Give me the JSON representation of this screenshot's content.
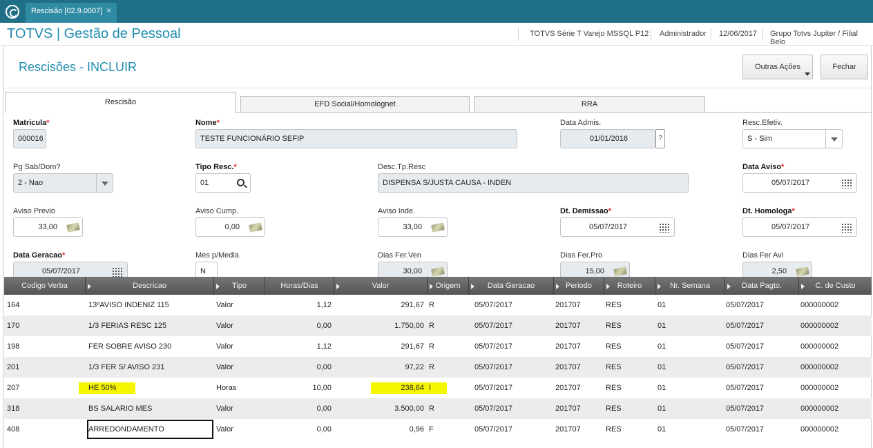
{
  "window": {
    "tab_title": "Rescisão [02.9.0007]",
    "close_glyph": "×"
  },
  "header": {
    "brand": "TOTVS | Gestão de Pessoal",
    "environment": "TOTVS Série T Varejo MSSQL P12",
    "user": "Administrador",
    "date": "12/06/2017",
    "company": "Grupo Totvs Jupiter / Filial Belo"
  },
  "page": {
    "title": "Rescisões - INCLUIR",
    "more_actions": "Outras Ações",
    "close": "Fechar"
  },
  "tabs": [
    "Rescisão",
    "EFD Social/Homolognet",
    "RRA"
  ],
  "form": {
    "matricula": {
      "label": "Matricula",
      "value": "000016",
      "required": "*"
    },
    "nome": {
      "label": "Nome",
      "value": "TESTE FUNCIONÁRIO SEFIP",
      "required": "*"
    },
    "data_admis": {
      "label": "Data Admis.",
      "value": "01/01/2016",
      "help": "?"
    },
    "resc_efetiv": {
      "label": "Resc.Efetiv.",
      "value": "S - Sim"
    },
    "pg_sab_dom": {
      "label": "Pg Sab/Dom?",
      "value": "2 - Nao"
    },
    "tipo_resc": {
      "label": "Tipo Resc.",
      "value": "01",
      "required": "*"
    },
    "desc_tp_resc": {
      "label": "Desc.Tp.Resc",
      "value": "DISPENSA S/JUSTA CAUSA - INDEN"
    },
    "data_aviso": {
      "label": "Data Aviso",
      "value": "05/07/2017",
      "required": "*"
    },
    "aviso_previo": {
      "label": "Aviso Previo",
      "value": "33,00"
    },
    "aviso_cump": {
      "label": "Aviso Cump.",
      "value": "0,00"
    },
    "aviso_inde": {
      "label": "Aviso Inde.",
      "value": "33,00"
    },
    "dt_demissao": {
      "label": "Dt. Demissao",
      "value": "05/07/2017",
      "required": "*"
    },
    "dt_homologa": {
      "label": "Dt. Homologa",
      "value": "05/07/2017",
      "required": "*"
    },
    "data_geracao": {
      "label": "Data Geracao",
      "value": "05/07/2017",
      "required": "*"
    },
    "mes_p_media": {
      "label": "Mes p/Media",
      "value": "N"
    },
    "dias_fer_ven": {
      "label": "Dias Fer.Ven",
      "value": "30,00"
    },
    "dias_fer_pro": {
      "label": "Dias Fer.Pro",
      "value": "15,00"
    },
    "dias_fer_avi": {
      "label": "Dias Fer Avi",
      "value": "2,50"
    }
  },
  "grid": {
    "columns": [
      "Codigo Verba",
      "Descricao",
      "Tipo",
      "Horas/Dias",
      "Valor",
      "Origem",
      "Data Geracao",
      "Periodo",
      "Roteiro",
      "Nr. Semana",
      "Data Pagto.",
      "C. de Custo"
    ],
    "rows": [
      [
        "164",
        "13ºAVISO INDENIZ 115",
        "Valor",
        "1,12",
        "291,67",
        "R",
        "05/07/2017",
        "201707",
        "RES",
        "01",
        "05/07/2017",
        "000000002"
      ],
      [
        "170",
        "1/3 FERIAS RESC 125",
        "Valor",
        "0,00",
        "1.750,00",
        "R",
        "05/07/2017",
        "201707",
        "RES",
        "01",
        "05/07/2017",
        "000000002"
      ],
      [
        "198",
        "FER SOBRE AVISO 230",
        "Valor",
        "1,12",
        "291,67",
        "R",
        "05/07/2017",
        "201707",
        "RES",
        "01",
        "05/07/2017",
        "000000002"
      ],
      [
        "201",
        "1/3 FER S/ AVISO 231",
        "Valor",
        "0,00",
        "97,22",
        "R",
        "05/07/2017",
        "201707",
        "RES",
        "01",
        "05/07/2017",
        "000000002"
      ],
      [
        "207",
        "HE  50%",
        "Horas",
        "10,00",
        "238,64",
        "I",
        "05/07/2017",
        "201707",
        "RES",
        "01",
        "05/07/2017",
        "000000002"
      ],
      [
        "318",
        "BS SALARIO MES",
        "Valor",
        "0,00",
        "3.500,00",
        "R",
        "05/07/2017",
        "201707",
        "RES",
        "01",
        "05/07/2017",
        "000000002"
      ],
      [
        "408",
        "ARREDONDAMENTO",
        "Valor",
        "0,00",
        "0,96",
        "F",
        "05/07/2017",
        "201707",
        "RES",
        "01",
        "05/07/2017",
        "000000002"
      ]
    ]
  },
  "colors": {
    "topbar": "#1f6f86",
    "brand": "#1f8db0",
    "required": "#e0262d",
    "highlight": "#f6f600"
  }
}
